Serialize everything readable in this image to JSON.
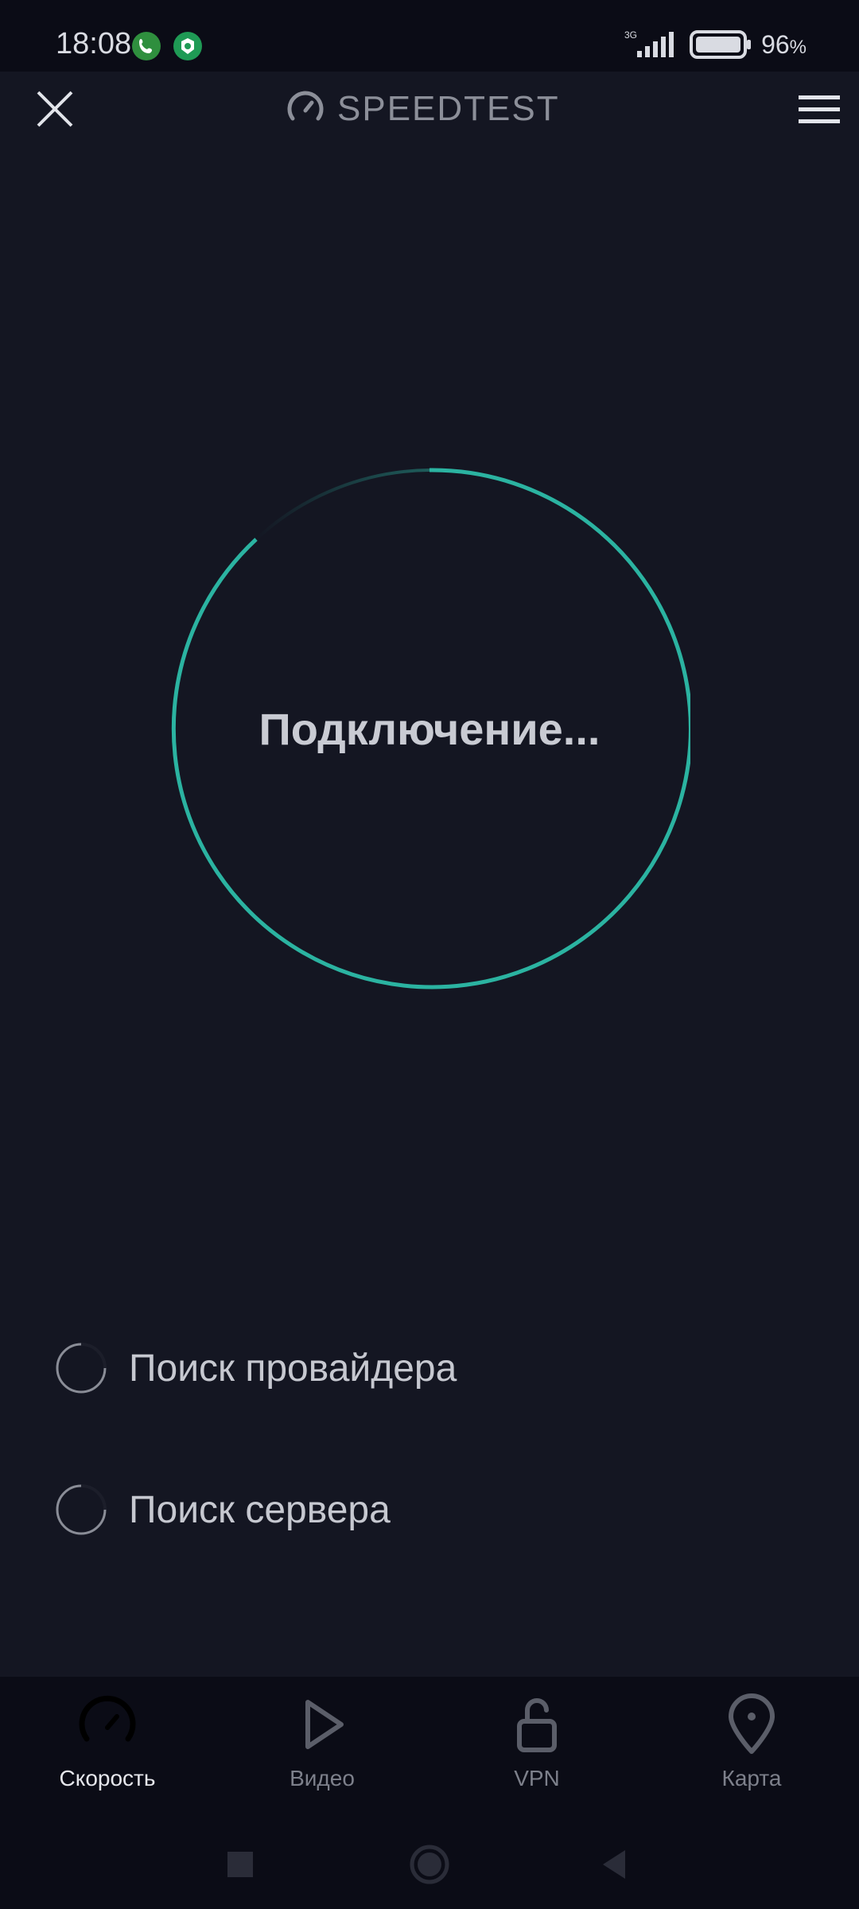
{
  "status_bar": {
    "time": "18:08",
    "network": "3G",
    "battery": "96",
    "battery_unit": "%"
  },
  "app_bar": {
    "brand": "SPEEDTEST",
    "close_icon": "close-icon",
    "menu_icon": "hamburger-menu-icon"
  },
  "gauge": {
    "status": "Подключение..."
  },
  "steps": [
    {
      "label": "Поиск провайдера"
    },
    {
      "label": "Поиск сервера"
    }
  ],
  "bottom_nav": [
    {
      "label": "Скорость",
      "icon": "speedometer-icon",
      "active": true
    },
    {
      "label": "Видео",
      "icon": "play-icon",
      "active": false
    },
    {
      "label": "VPN",
      "icon": "unlock-icon",
      "active": false
    },
    {
      "label": "Карта",
      "icon": "map-pin-icon",
      "active": false
    }
  ],
  "colors": {
    "background": "#141622",
    "accent": "#2bb3a1",
    "bar": "#0b0c16"
  }
}
